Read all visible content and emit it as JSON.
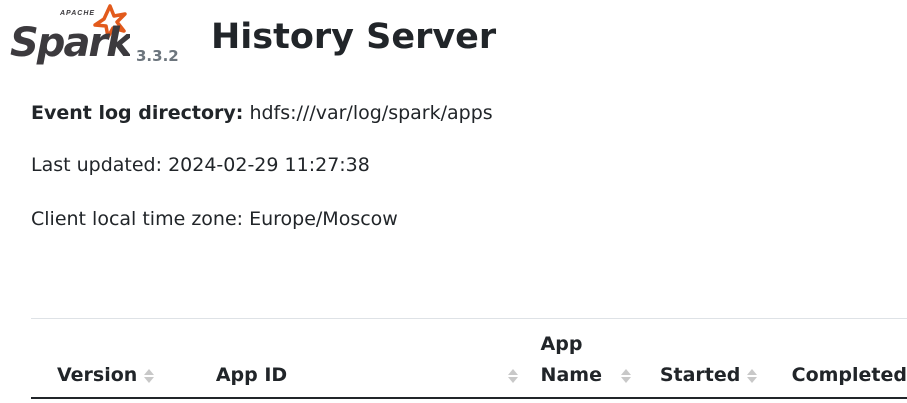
{
  "header": {
    "logo_icon": "apache-spark-logo",
    "version": "3.3.2",
    "title": "History Server"
  },
  "info": {
    "event_log_label": "Event log directory:",
    "event_log_value": "hdfs:///var/log/spark/apps",
    "last_updated": "Last updated: 2024-02-29 11:27:38",
    "time_zone": "Client local time zone: Europe/Moscow"
  },
  "table": {
    "columns": [
      {
        "label": "Version",
        "sort_icon": "sort-icon"
      },
      {
        "label": "App ID",
        "sort_icon": "sort-icon"
      },
      {
        "label": "App\nName",
        "sort_icon": "sort-icon"
      },
      {
        "label": "Started",
        "sort_icon": "sort-icon"
      },
      {
        "label": "Completed",
        "sort_icon": ""
      }
    ]
  },
  "colors": {
    "text": "#212529",
    "muted": "#6c757d",
    "spark_orange": "#e25a1c",
    "spark_dark": "#3c3a3e",
    "sort_gray": "#c8c8c8"
  }
}
